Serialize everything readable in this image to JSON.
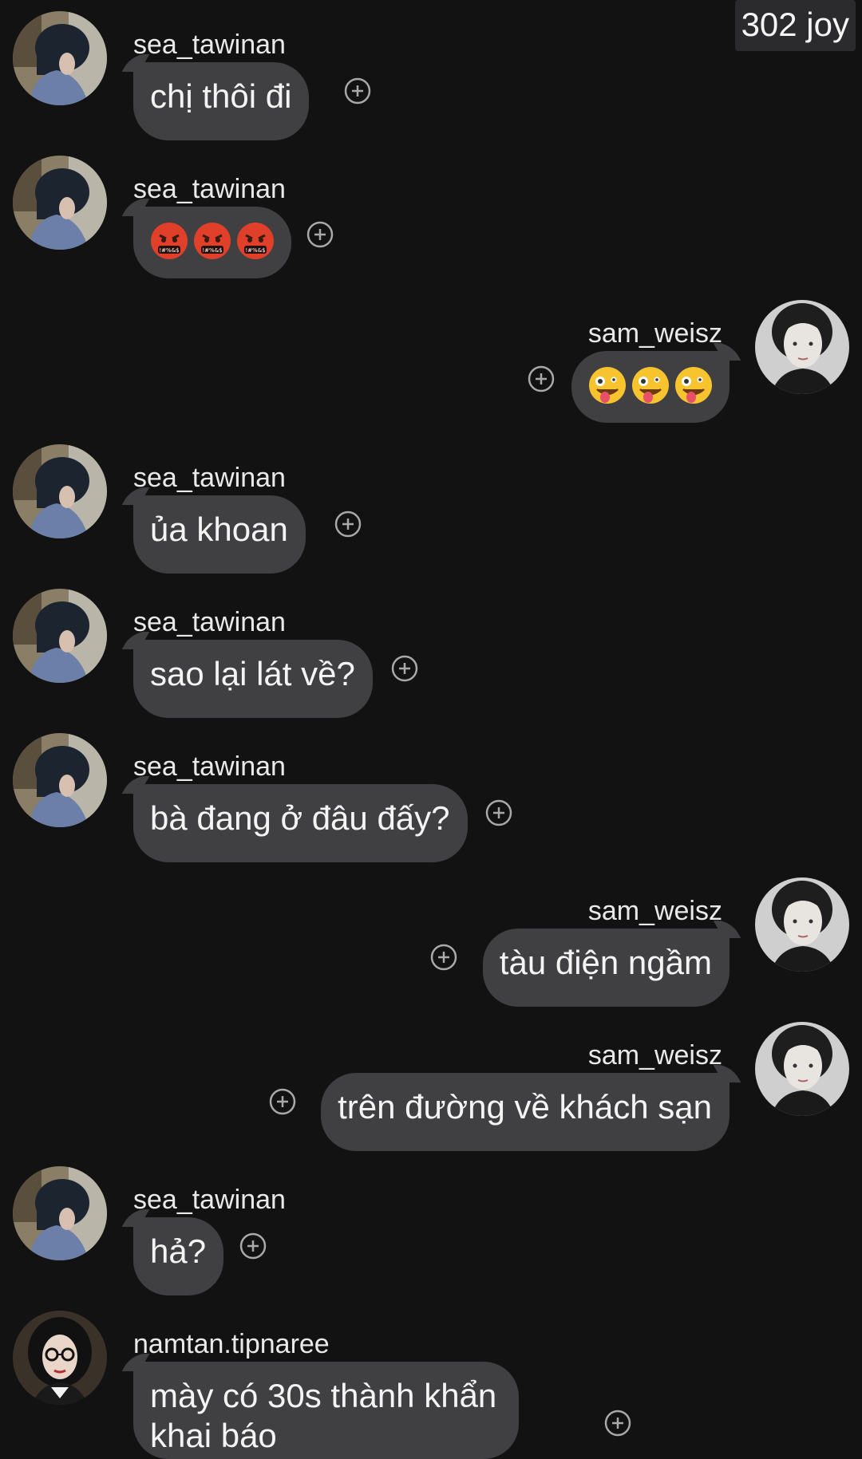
{
  "overlay": {
    "badge_text": "302 joy"
  },
  "colors": {
    "background": "#121213",
    "bubble": "#404042",
    "text": "#f4f4f4",
    "react_icon": "#a9a9aa"
  },
  "messages": [
    {
      "side": "left",
      "user": "sea_tawinan",
      "avatar": "sea-avatar",
      "text": "chị thôi đi"
    },
    {
      "side": "left",
      "user": "sea_tawinan",
      "avatar": "sea-avatar",
      "emojis": [
        "cursing-face-emoji",
        "cursing-face-emoji",
        "cursing-face-emoji"
      ]
    },
    {
      "side": "right",
      "user": "sam_weisz",
      "avatar": "sam-avatar",
      "emojis": [
        "zany-face-emoji",
        "zany-face-emoji",
        "zany-face-emoji"
      ]
    },
    {
      "side": "left",
      "user": "sea_tawinan",
      "avatar": "sea-avatar",
      "text": "ủa khoan"
    },
    {
      "side": "left",
      "user": "sea_tawinan",
      "avatar": "sea-avatar",
      "text": "sao lại lát về?"
    },
    {
      "side": "left",
      "user": "sea_tawinan",
      "avatar": "sea-avatar",
      "text": "bà đang ở đâu đấy?"
    },
    {
      "side": "right",
      "user": "sam_weisz",
      "avatar": "sam-avatar",
      "text": "tàu điện ngầm"
    },
    {
      "side": "right",
      "user": "sam_weisz",
      "avatar": "sam-avatar",
      "text": "trên đường về khách sạn"
    },
    {
      "side": "left",
      "user": "sea_tawinan",
      "avatar": "sea-avatar",
      "text": "hả?"
    },
    {
      "side": "left",
      "user": "namtan.tipnaree",
      "avatar": "namtan-avatar",
      "text": "mày có 30s thành khẩn khai báo"
    }
  ]
}
